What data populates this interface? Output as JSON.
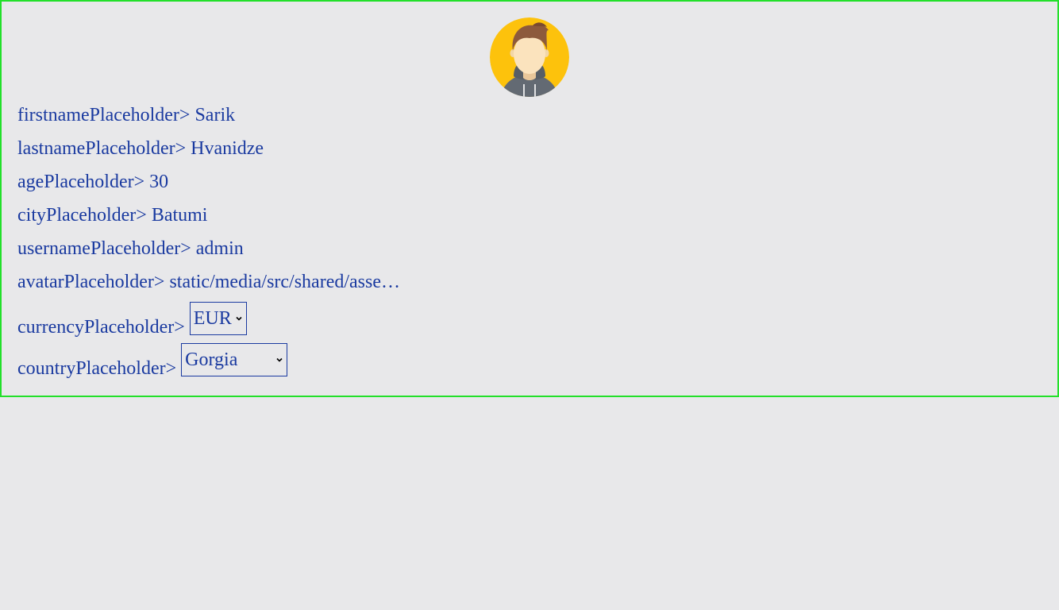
{
  "profile": {
    "avatar_icon": "user-avatar-icon",
    "fields": [
      {
        "label": "firstnamePlaceholder>",
        "value": "Sarik"
      },
      {
        "label": "lastnamePlaceholder>",
        "value": "Hvanidze"
      },
      {
        "label": "agePlaceholder>",
        "value": "30"
      },
      {
        "label": "cityPlaceholder>",
        "value": "Batumi"
      },
      {
        "label": "usernamePlaceholder>",
        "value": "admin"
      },
      {
        "label": "avatarPlaceholder>",
        "value": "static/media/src/shared/asse…"
      }
    ],
    "currency": {
      "label": "currencyPlaceholder>",
      "selected": "EUR"
    },
    "country": {
      "label": "countryPlaceholder>",
      "selected": "Gorgia"
    }
  },
  "colors": {
    "border": "#22e02a",
    "text": "#1a3aa0",
    "background": "#e8e8ea",
    "avatar_bg": "#fdc20c"
  }
}
